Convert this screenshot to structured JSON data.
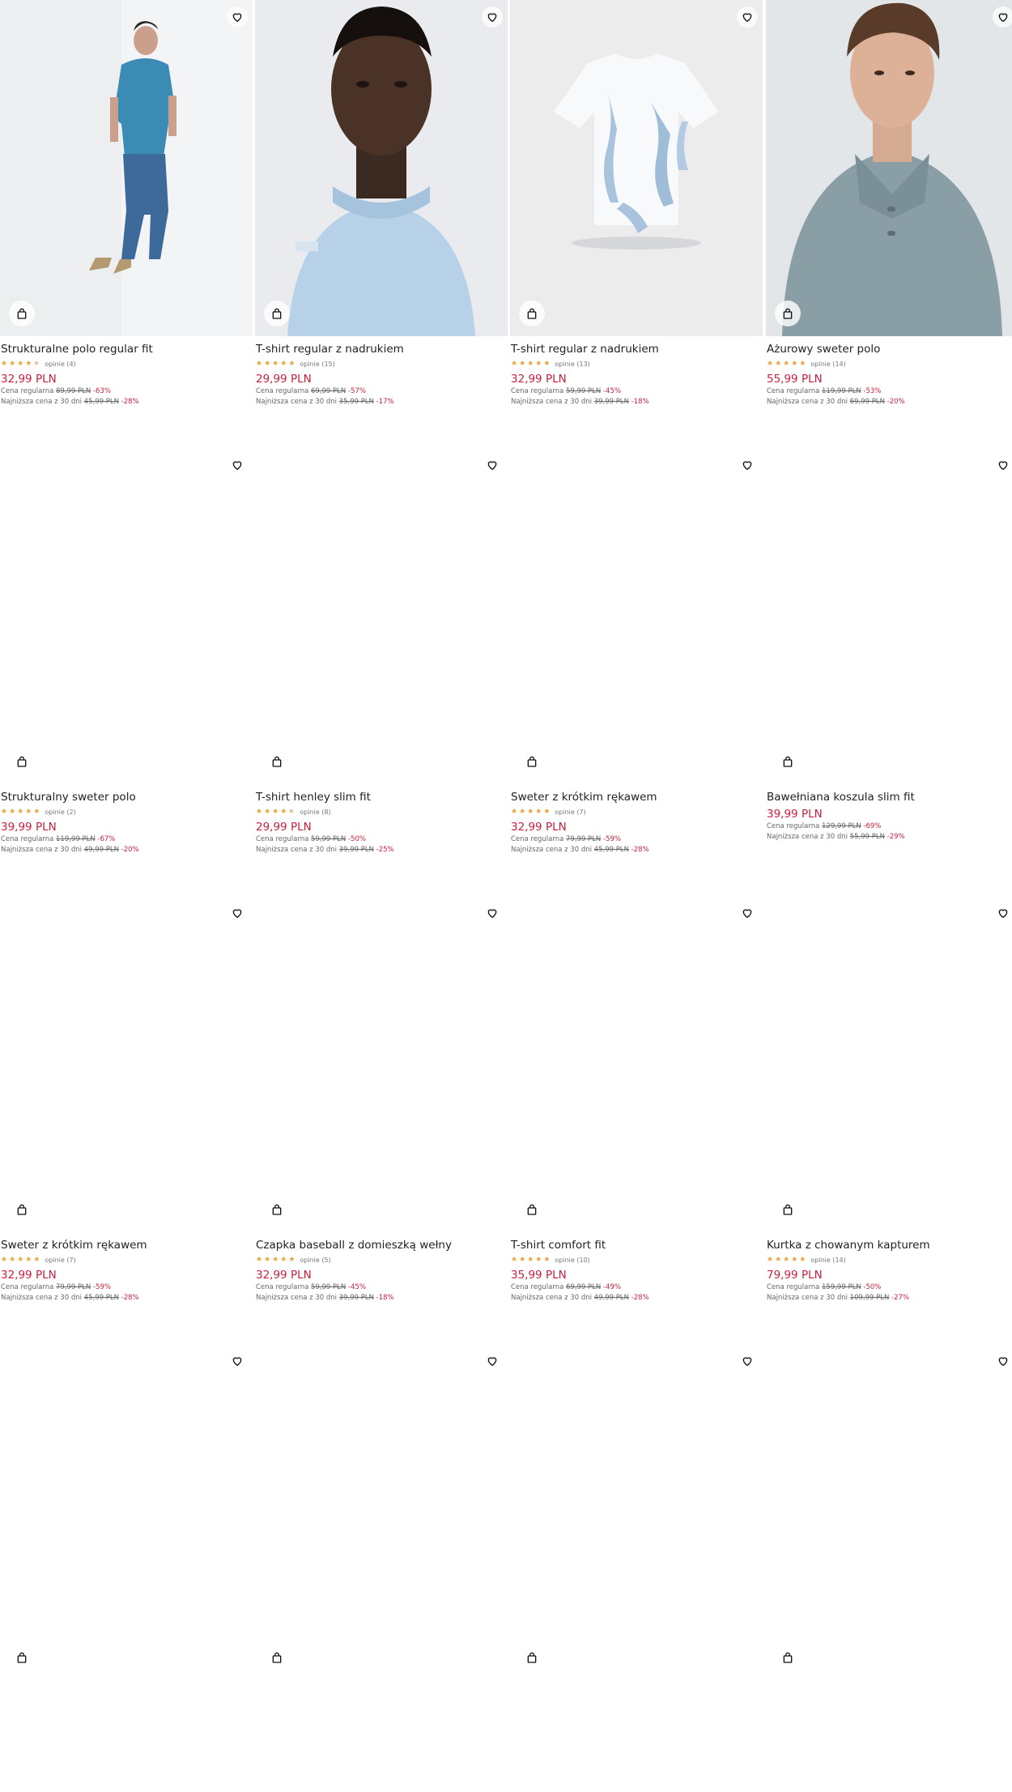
{
  "rows": [
    {
      "products": [
        {
          "name": "Strukturalne polo regular fit",
          "stars": [
            1,
            1,
            1,
            1,
            0.5
          ],
          "reviews": "opinie (4)",
          "price": "32,99 PLN",
          "regular_label": "Cena regularna",
          "regular_old": "89,99 PLN",
          "regular_disc": "-63%",
          "lowest_label": "Najniższa cena z 30 dni",
          "lowest_old": "45,99 PLN",
          "lowest_disc": "-28%"
        },
        {
          "name": "T-shirt regular z nadrukiem",
          "stars": [
            1,
            1,
            1,
            1,
            1
          ],
          "reviews": "opinie (15)",
          "price": "29,99 PLN",
          "regular_label": "Cena regularna",
          "regular_old": "69,99 PLN",
          "regular_disc": "-57%",
          "lowest_label": "Najniższa cena z 30 dni",
          "lowest_old": "35,99 PLN",
          "lowest_disc": "-17%"
        },
        {
          "name": "T-shirt regular z nadrukiem",
          "stars": [
            1,
            1,
            1,
            1,
            1
          ],
          "reviews": "opinie (13)",
          "price": "32,99 PLN",
          "regular_label": "Cena regularna",
          "regular_old": "59,99 PLN",
          "regular_disc": "-45%",
          "lowest_label": "Najniższa cena z 30 dni",
          "lowest_old": "39,99 PLN",
          "lowest_disc": "-18%"
        },
        {
          "name": "Ażurowy sweter polo",
          "stars": [
            1,
            1,
            1,
            1,
            1
          ],
          "reviews": "opinie (14)",
          "price": "55,99 PLN",
          "regular_label": "Cena regularna",
          "regular_old": "119,99 PLN",
          "regular_disc": "-53%",
          "lowest_label": "Najniższa cena z 30 dni",
          "lowest_old": "69,99 PLN",
          "lowest_disc": "-20%"
        }
      ]
    },
    {
      "products": [
        {
          "name": "Strukturalny sweter polo",
          "stars": [
            1,
            1,
            1,
            1,
            1
          ],
          "reviews": "opinie (2)",
          "price": "39,99 PLN",
          "regular_label": "Cena regularna",
          "regular_old": "119,99 PLN",
          "regular_disc": "-67%",
          "lowest_label": "Najniższa cena z 30 dni",
          "lowest_old": "49,99 PLN",
          "lowest_disc": "-20%"
        },
        {
          "name": "T-shirt henley slim fit",
          "stars": [
            1,
            1,
            1,
            1,
            0.5
          ],
          "reviews": "opinie (8)",
          "price": "29,99 PLN",
          "regular_label": "Cena regularna",
          "regular_old": "59,99 PLN",
          "regular_disc": "-50%",
          "lowest_label": "Najniższa cena z 30 dni",
          "lowest_old": "39,99 PLN",
          "lowest_disc": "-25%"
        },
        {
          "name": "Sweter z krótkim rękawem",
          "stars": [
            1,
            1,
            1,
            1,
            1
          ],
          "reviews": "opinie (7)",
          "price": "32,99 PLN",
          "regular_label": "Cena regularna",
          "regular_old": "79,99 PLN",
          "regular_disc": "-59%",
          "lowest_label": "Najniższa cena z 30 dni",
          "lowest_old": "45,99 PLN",
          "lowest_disc": "-28%"
        },
        {
          "name": "Bawełniana koszula slim fit",
          "stars": [],
          "reviews": "",
          "price": "39,99 PLN",
          "regular_label": "Cena regularna",
          "regular_old": "129,99 PLN",
          "regular_disc": "-69%",
          "lowest_label": "Najniższa cena z 30 dni",
          "lowest_old": "55,99 PLN",
          "lowest_disc": "-29%"
        }
      ]
    },
    {
      "products": [
        {
          "name": "Sweter z krótkim rękawem",
          "stars": [
            1,
            1,
            1,
            1,
            1
          ],
          "reviews": "opinie (7)",
          "price": "32,99 PLN",
          "regular_label": "Cena regularna",
          "regular_old": "79,99 PLN",
          "regular_disc": "-59%",
          "lowest_label": "Najniższa cena z 30 dni",
          "lowest_old": "45,99 PLN",
          "lowest_disc": "-28%"
        },
        {
          "name": "Czapka baseball z domieszką wełny",
          "stars": [
            1,
            1,
            1,
            1,
            1
          ],
          "reviews": "opinie (5)",
          "price": "32,99 PLN",
          "regular_label": "Cena regularna",
          "regular_old": "59,99 PLN",
          "regular_disc": "-45%",
          "lowest_label": "Najniższa cena z 30 dni",
          "lowest_old": "39,99 PLN",
          "lowest_disc": "-18%"
        },
        {
          "name": "T-shirt comfort fit",
          "stars": [
            1,
            1,
            1,
            1,
            1
          ],
          "reviews": "opinie (10)",
          "price": "35,99 PLN",
          "regular_label": "Cena regularna",
          "regular_old": "69,99 PLN",
          "regular_disc": "-49%",
          "lowest_label": "Najniższa cena z 30 dni",
          "lowest_old": "49,99 PLN",
          "lowest_disc": "-28%"
        },
        {
          "name": "Kurtka z chowanym kapturem",
          "stars": [
            1,
            1,
            1,
            1,
            1
          ],
          "reviews": "opinie (14)",
          "price": "79,99 PLN",
          "regular_label": "Cena regularna",
          "regular_old": "159,99 PLN",
          "regular_disc": "-50%",
          "lowest_label": "Najniższa cena z 30 dni",
          "lowest_old": "109,99 PLN",
          "lowest_disc": "-27%"
        }
      ]
    },
    {
      "products": [
        {
          "name": "",
          "stars": [],
          "reviews": "",
          "price": "",
          "regular_label": "",
          "regular_old": "",
          "regular_disc": "",
          "lowest_label": "",
          "lowest_old": "",
          "lowest_disc": ""
        },
        {
          "name": "",
          "stars": [],
          "reviews": "",
          "price": "",
          "regular_label": "",
          "regular_old": "",
          "regular_disc": "",
          "lowest_label": "",
          "lowest_old": "",
          "lowest_disc": ""
        },
        {
          "name": "",
          "stars": [],
          "reviews": "",
          "price": "",
          "regular_label": "",
          "regular_old": "",
          "regular_disc": "",
          "lowest_label": "",
          "lowest_old": "",
          "lowest_disc": ""
        },
        {
          "name": "",
          "stars": [],
          "reviews": "",
          "price": "",
          "regular_label": "",
          "regular_old": "",
          "regular_disc": "",
          "lowest_label": "",
          "lowest_old": "",
          "lowest_disc": ""
        }
      ]
    }
  ],
  "icons": {
    "favorite": "heart-icon",
    "add_to_cart": "shopping-bag-icon"
  },
  "colors": {
    "price": "#c8203e",
    "discount": "#c8203e",
    "stars": "#e8a33a"
  }
}
